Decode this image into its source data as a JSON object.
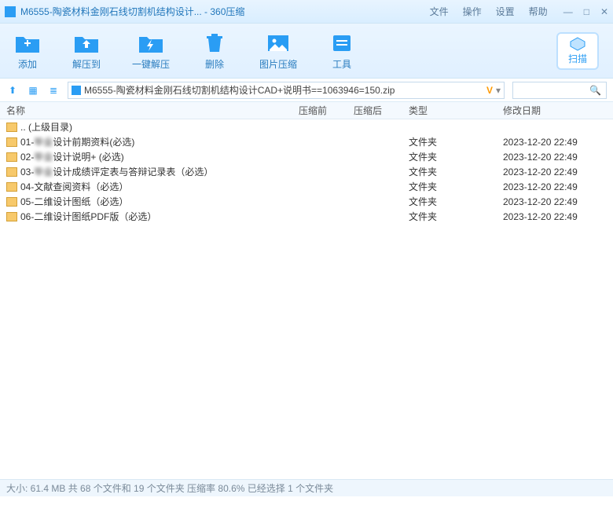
{
  "titlebar": {
    "title": "M6555-陶瓷材料金刚石线切割机结构设计... - 360压缩",
    "menu": [
      "文件",
      "操作",
      "设置",
      "帮助"
    ]
  },
  "toolbar": {
    "items": [
      {
        "label": "添加"
      },
      {
        "label": "解压到"
      },
      {
        "label": "一键解压"
      },
      {
        "label": "删除"
      },
      {
        "label": "图片压缩"
      },
      {
        "label": "工具"
      }
    ],
    "scan": "扫描"
  },
  "path": {
    "filename": "M6555-陶瓷材料金刚石线切割机结构设计CAD+说明书==1063946=150.zip"
  },
  "columns": {
    "name": "名称",
    "before": "压缩前",
    "after": "压缩后",
    "type": "类型",
    "date": "修改日期"
  },
  "rows": [
    {
      "name_pre": ".. (上级目录)",
      "name_blur": "",
      "name_post": "",
      "type": "",
      "date": ""
    },
    {
      "name_pre": "01-",
      "name_blur": "毕业",
      "name_post": "设计前期资料(必选)",
      "type": "文件夹",
      "date": "2023-12-20 22:49"
    },
    {
      "name_pre": "02-",
      "name_blur": "毕业",
      "name_post": "设计说明+ (必选)",
      "type": "文件夹",
      "date": "2023-12-20 22:49"
    },
    {
      "name_pre": "03-",
      "name_blur": "毕业",
      "name_post": "设计成绩评定表与答辩记录表（必选）",
      "type": "文件夹",
      "date": "2023-12-20 22:49"
    },
    {
      "name_pre": "04-文献查阅资料（必选）",
      "name_blur": "",
      "name_post": "",
      "type": "文件夹",
      "date": "2023-12-20 22:49"
    },
    {
      "name_pre": "05-二维设计图纸（必选）",
      "name_blur": "",
      "name_post": "",
      "type": "文件夹",
      "date": "2023-12-20 22:49"
    },
    {
      "name_pre": "06-二维设计图纸PDF版（必选）",
      "name_blur": "",
      "name_post": "",
      "type": "文件夹",
      "date": "2023-12-20 22:49"
    }
  ],
  "status": "大小: 61.4 MB 共 68 个文件和 19 个文件夹 压缩率 80.6% 已经选择 1 个文件夹"
}
